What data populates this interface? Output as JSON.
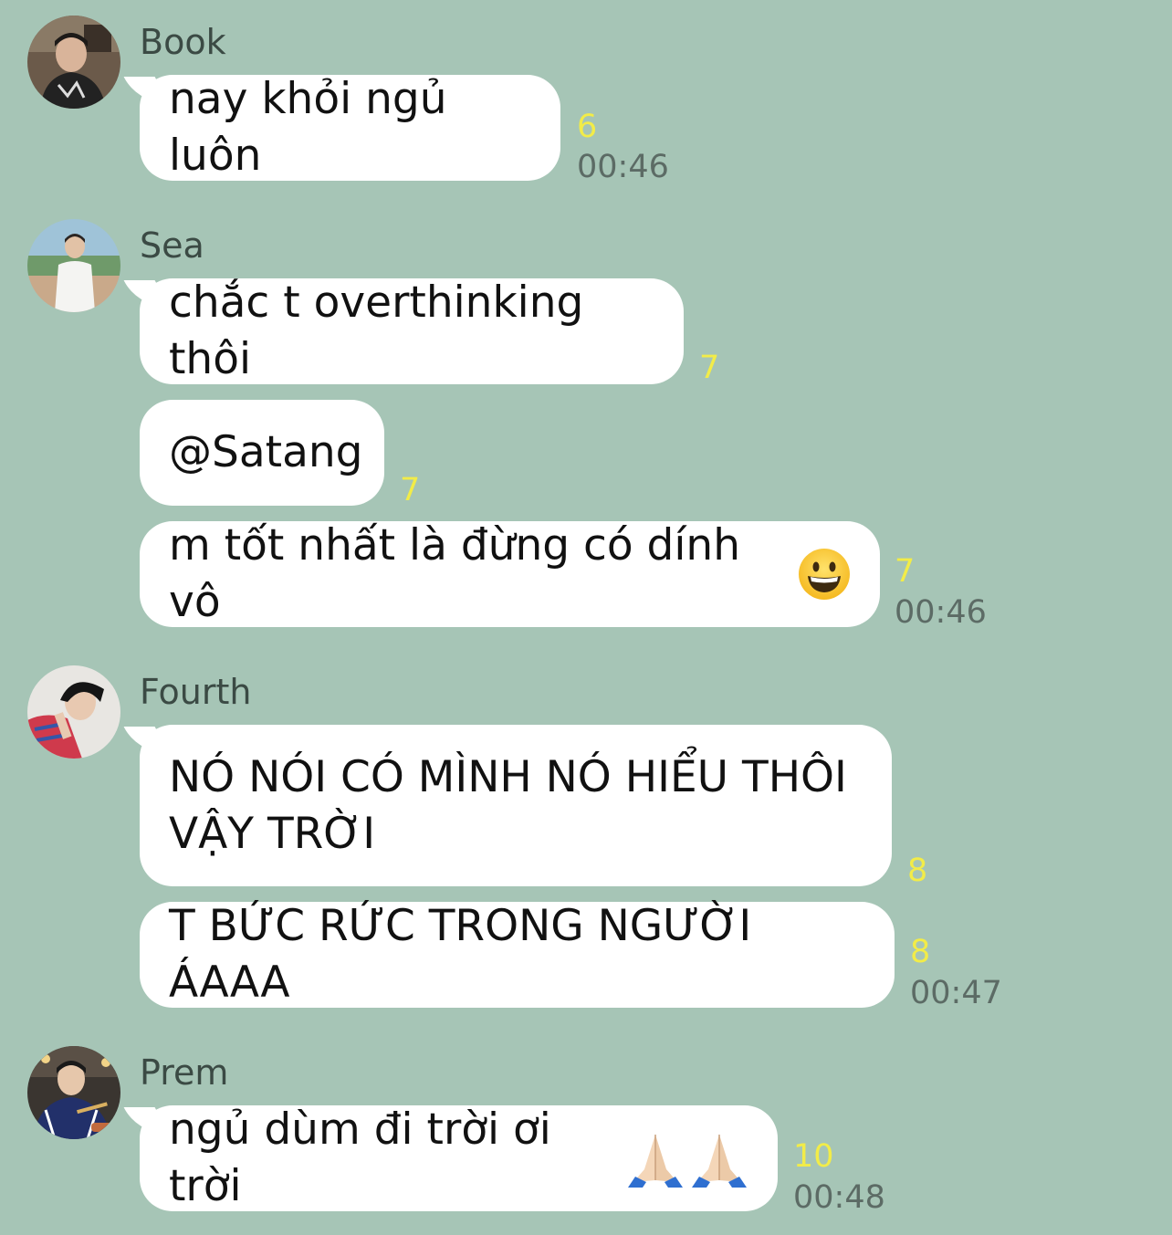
{
  "messages": [
    {
      "sender": "Book",
      "items": [
        {
          "text": "nay khỏi ngủ luôn",
          "read": "6",
          "time": "00:46"
        }
      ]
    },
    {
      "sender": "Sea",
      "items": [
        {
          "text": "chắc t overthinking thôi",
          "read": "7"
        },
        {
          "text": "@Satang",
          "read": "7"
        },
        {
          "text": "m tốt nhất là đừng có dính vô",
          "emoji": "grinning-face-emoji",
          "read": "7",
          "time": "00:46"
        }
      ]
    },
    {
      "sender": "Fourth",
      "items": [
        {
          "text": "NÓ NÓI CÓ MÌNH NÓ HIỂU THÔI\nVẬY TRỜI",
          "read": "8"
        },
        {
          "text": "T BỨC RỨC TRONG NGƯỜI ÁAAA",
          "read": "8",
          "time": "00:47"
        }
      ]
    },
    {
      "sender": "Prem",
      "items": [
        {
          "text": "ngủ dùm đi trời ơi trời",
          "emoji": "folded-hands-emoji",
          "read": "10",
          "time": "00:48"
        }
      ]
    }
  ]
}
